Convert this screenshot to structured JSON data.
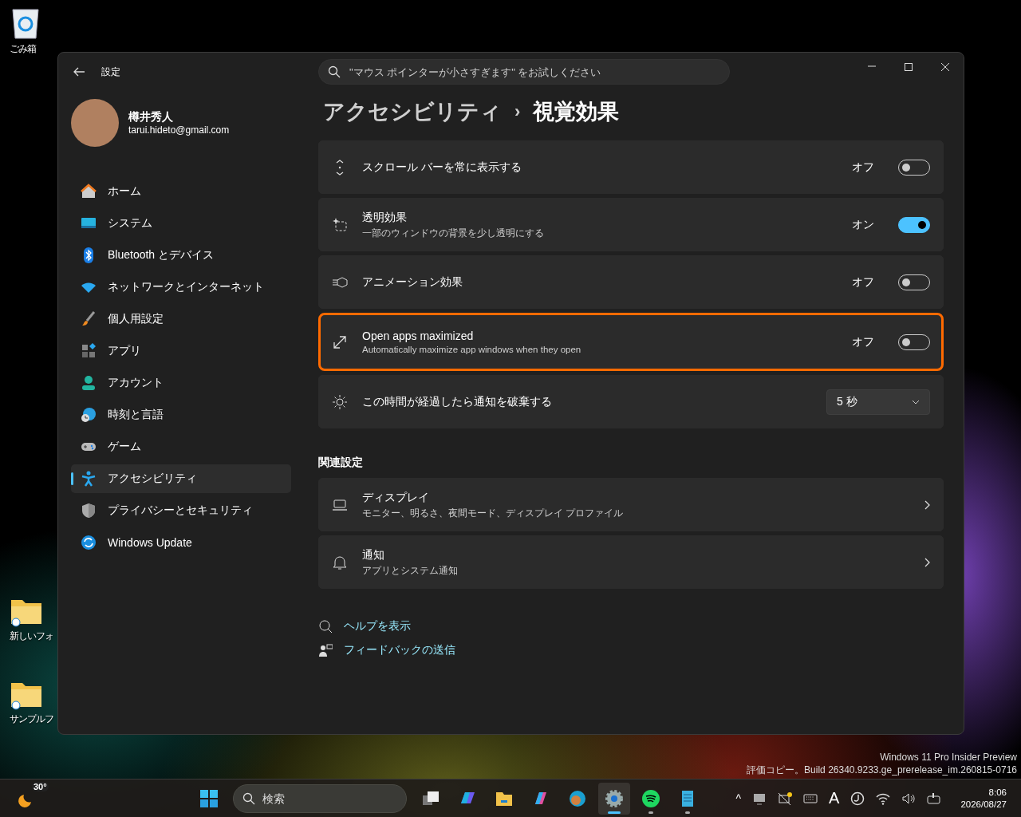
{
  "desktop_icons": [
    {
      "label": "ごみ箱",
      "kind": "recycle"
    },
    {
      "label": "新しいフォ",
      "kind": "folder"
    },
    {
      "label": "サンプルフ",
      "kind": "folder"
    }
  ],
  "window": {
    "title": "設定",
    "search": {
      "placeholder": "\"マウス ポインターが小さすぎます\" をお試しください"
    },
    "user": {
      "name": "樽井秀人",
      "email": "tarui.hideto@gmail.com"
    },
    "nav": [
      {
        "label": "ホーム",
        "selected": false
      },
      {
        "label": "システム",
        "selected": false
      },
      {
        "label": "Bluetooth とデバイス",
        "selected": false
      },
      {
        "label": "ネットワークとインターネット",
        "selected": false
      },
      {
        "label": "個人用設定",
        "selected": false
      },
      {
        "label": "アプリ",
        "selected": false
      },
      {
        "label": "アカウント",
        "selected": false
      },
      {
        "label": "時刻と言語",
        "selected": false
      },
      {
        "label": "ゲーム",
        "selected": false
      },
      {
        "label": "アクセシビリティ",
        "selected": true
      },
      {
        "label": "プライバシーとセキュリティ",
        "selected": false
      },
      {
        "label": "Windows Update",
        "selected": false
      }
    ],
    "breadcrumb": {
      "parent": "アクセシビリティ",
      "separator": "›",
      "current": "視覚効果"
    },
    "settings": [
      {
        "kind": "toggle",
        "title": "スクロール バーを常に表示する",
        "state_label": "オフ",
        "on": false,
        "highlighted": false
      },
      {
        "kind": "toggle",
        "title": "透明効果",
        "subtitle": "一部のウィンドウの背景を少し透明にする",
        "state_label": "オン",
        "on": true,
        "highlighted": false
      },
      {
        "kind": "toggle",
        "title": "アニメーション効果",
        "state_label": "オフ",
        "on": false,
        "highlighted": false
      },
      {
        "kind": "toggle",
        "title": "Open apps maximized",
        "subtitle": "Automatically maximize app windows when they open",
        "state_label": "オフ",
        "on": false,
        "highlighted": true
      },
      {
        "kind": "dropdown",
        "title": "この時間が経過したら通知を破棄する",
        "value": "5 秒",
        "highlighted": false
      }
    ],
    "related": {
      "heading": "関連設定",
      "items": [
        {
          "title": "ディスプレイ",
          "subtitle": "モニター、明るさ、夜間モード、ディスプレイ プロファイル"
        },
        {
          "title": "通知",
          "subtitle": "アプリとシステム通知"
        }
      ]
    },
    "links": [
      "ヘルプを表示",
      "フィードバックの送信"
    ]
  },
  "build_info": [
    "Windows 11 Pro Insider Preview",
    "評価コピー。Build 26340.9233.ge_prerelease_im.260815-0716"
  ],
  "taskbar": {
    "weather": "30°",
    "search_placeholder": "検索",
    "apps": [
      {
        "running": false,
        "selected": false
      },
      {
        "running": false,
        "selected": false
      },
      {
        "running": false,
        "selected": false
      },
      {
        "running": false,
        "selected": false
      },
      {
        "running": false,
        "selected": false
      },
      {
        "running": true,
        "selected": true
      },
      {
        "running": true,
        "selected": false
      },
      {
        "running": true,
        "selected": false
      }
    ],
    "tray_caret": "^",
    "ime": "A",
    "time": "8:06",
    "date": "2026/08/27"
  }
}
